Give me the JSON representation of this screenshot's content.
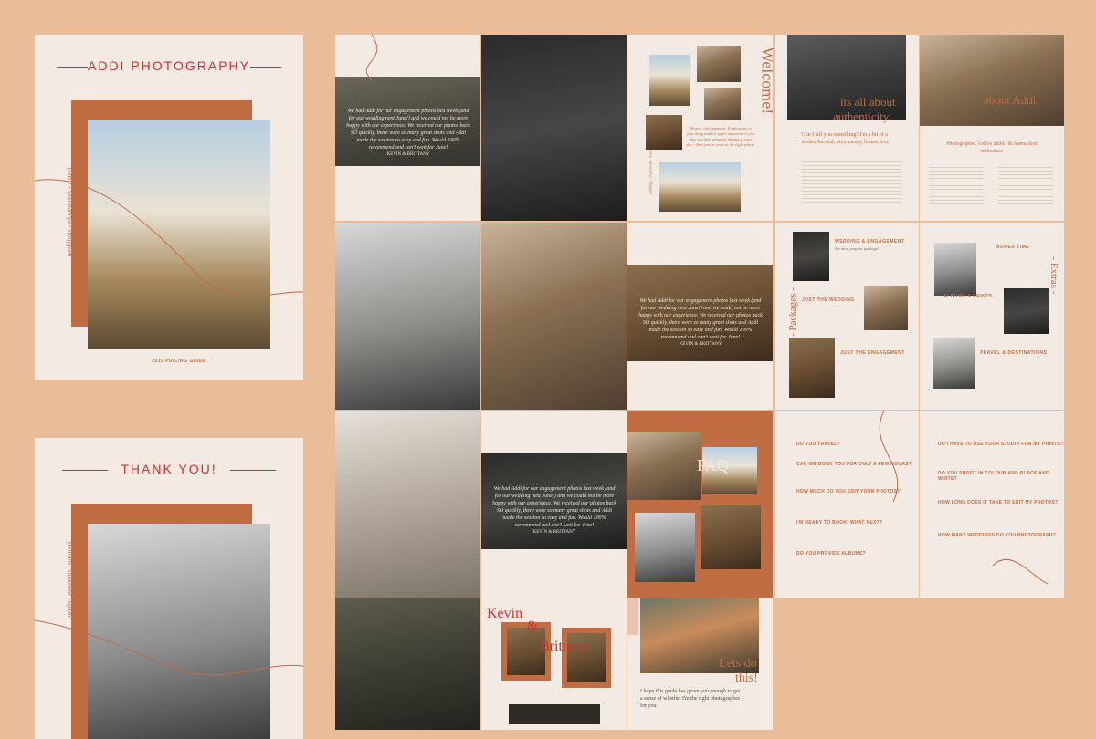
{
  "cover": {
    "title": "ADDI PHOTOGRAPHY",
    "vertical_tagline": "weddings - elopements - travel",
    "guide_label": "2019 PRICING GUIDE"
  },
  "thanks": {
    "title": "THANK YOU!",
    "vertical_tagline": "perfect moments captured."
  },
  "testimonial": {
    "quote": "We had Addi for our engagement photos last week (and for our wedding next June!) and we could not be more happy with our experience. We received our photos back SO quickly, there were so many great shots and Addi made the session so easy and fun. Would 100% recommend and can't wait for June!",
    "author": "KEVIN & BRITTANY"
  },
  "welcome": {
    "heading": "Welcome!",
    "body": "Honest, real moments. If adventure is your thing and it's super important to you that you have amazing images of your day - then you've come to the right place!",
    "vertical_tagline": "weddings - elopements - travel"
  },
  "authenticity": {
    "heading_line1": "its all about",
    "heading_line2": "authenticity.",
    "lead": "Can I tell you something? I'm a bit of a sucker for real, dirty messy, honest love."
  },
  "about": {
    "heading": "about Addi",
    "lead": "Photographer, coffee addict & mama kort enthusiast."
  },
  "packages": {
    "vertical_title": "- Packages -",
    "items": [
      {
        "title": "WEDDING & ENGAGEMENT",
        "subtitle": "My most popular package!"
      },
      {
        "title": "JUST THE WEDDING"
      },
      {
        "title": "JUST THE ENGAGEMENT"
      }
    ]
  },
  "extras": {
    "vertical_title": "- Extras -",
    "items": [
      {
        "title": "ADDED TIME"
      },
      {
        "title": "ALBUMS & PRINTS"
      },
      {
        "title": "TRAVEL & DESTINATIONS"
      }
    ]
  },
  "faq": {
    "heading": "FAQ",
    "left": [
      "DO YOU TRAVEL?",
      "CAN WE BOOK YOU FOR ONLY A FEW HOURS?",
      "HOW MUCH DO YOU EDIT YOUR PHOTOS?",
      "I'M READY TO BOOK! WHAT NEXT?",
      "DO YOU PROVIDE ALBUMS?"
    ],
    "right": [
      "DO I HAVE TO USE YOUR STUDIO FOR MY PRINTS?",
      "DO YOU SHOOT IN COLOUR AND BLACK AND WHITE?",
      "HOW LONG DOES IT TAKE TO EDIT MY PHOTOS?",
      "HOW MANY WEDDINGS DO YOU PHOTOGRAPH?"
    ]
  },
  "couple": {
    "name1": "Kevin",
    "amp": "&",
    "name2": "Brittany"
  },
  "closing": {
    "heading_line1": "Lets do",
    "heading_line2": "this!",
    "body": "I hope this guide has given you enough to get a sense of whether I'm the right photographer for you."
  },
  "colors": {
    "background": "#e9bd9a",
    "paper": "#f3ebe3",
    "rust": "#c06d44",
    "red": "#c8322e"
  }
}
